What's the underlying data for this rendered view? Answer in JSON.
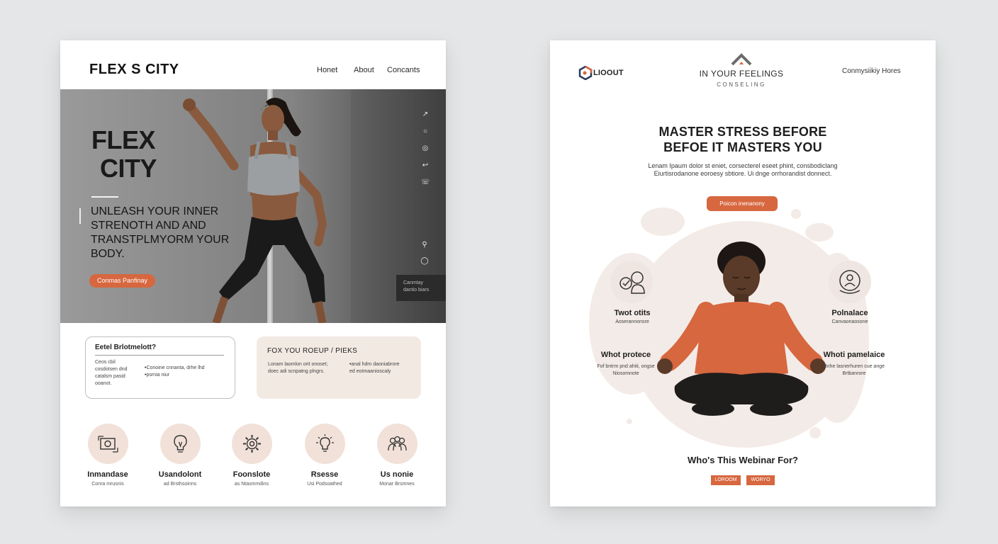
{
  "colors": {
    "background": "#e4e6e7",
    "accent": "#d7673f",
    "soft_peach": "#f3e9e3"
  },
  "left": {
    "logo": "FLEX S CITY",
    "nav": {
      "home": "Honet",
      "about": "About",
      "contacts": "Concants"
    },
    "hero": {
      "title_line1": "FLEX",
      "title_line2": "CITY",
      "subtitle": "UNLEASH YOUR INNER STRENOTH AND AND TRANSTPLMYORM YOUR BODY.",
      "cta": "Conmas Panfinay",
      "dark_box_line1": "Canmtay",
      "dark_box_line2": "dantio biars"
    },
    "box1": {
      "title": "Eetel Brlotmelott?",
      "col1": "Ceos cbil cosdotsen dnd catalsm pasid ooanot.",
      "bullet1": "Conoine cnnanta, drhe lhd",
      "bullet2": "psrnia niur"
    },
    "box2": {
      "title": "FOX YOU ROEUP / PIEKS",
      "col1": "Lonam laomlon orit onoset; doec adi scnpatng plngrs.",
      "bullet1": "anal hdm daoniabrore",
      "col2_rest": "ed eotmaanioscaly"
    },
    "features": [
      {
        "icon": "camera-icon",
        "label": "Inmandase",
        "sub": "Conra mrusnis"
      },
      {
        "icon": "lightbulb-icon",
        "label": "Usandolont",
        "sub": "ad Brsthsoinns"
      },
      {
        "icon": "gear-icon",
        "label": "Foonslote",
        "sub": "as Ntasmmdins"
      },
      {
        "icon": "idea-icon",
        "label": "Rsesse",
        "sub": "Usi Podsoathed"
      },
      {
        "icon": "people-icon",
        "label": "Us nonie",
        "sub": "Monar Brsmnes"
      }
    ]
  },
  "right": {
    "logo": "LIOOUT",
    "brand_title": "IN YOUR FEELINGS",
    "brand_sub": "CONSELING",
    "nav": "Conmysiikiy Hores",
    "headline_line1": "MASTER STRESS BEFORE",
    "headline_line2": "BEFOE IT MASTERS YOU",
    "desc_line1": "Lenam Ipaum dolor st eniet, corsecterel eseet phint, consbodiclang",
    "desc_line2": "Eiurtisrodanone eoroesy sbtiore. Ui dnge orrhorandist donnect.",
    "cta": "Poicon inenanony",
    "top_left": {
      "label": "Twot otits",
      "sub": "Aoserannonsre"
    },
    "top_right": {
      "label": "Polnalace",
      "sub": "Canvaonaosone"
    },
    "mid_left": {
      "label": "Whot protece",
      "sub": "Fof bntrm pnd ahiti, ongse Niosomnote"
    },
    "mid_right": {
      "label": "Whoti pamelaice",
      "sub": "Bnhe lasnerhuren cue ange Brtbanrore"
    },
    "section_title": "Who's This Webinar For?",
    "tag1": "LOROOM",
    "tag2": "WORYO"
  }
}
